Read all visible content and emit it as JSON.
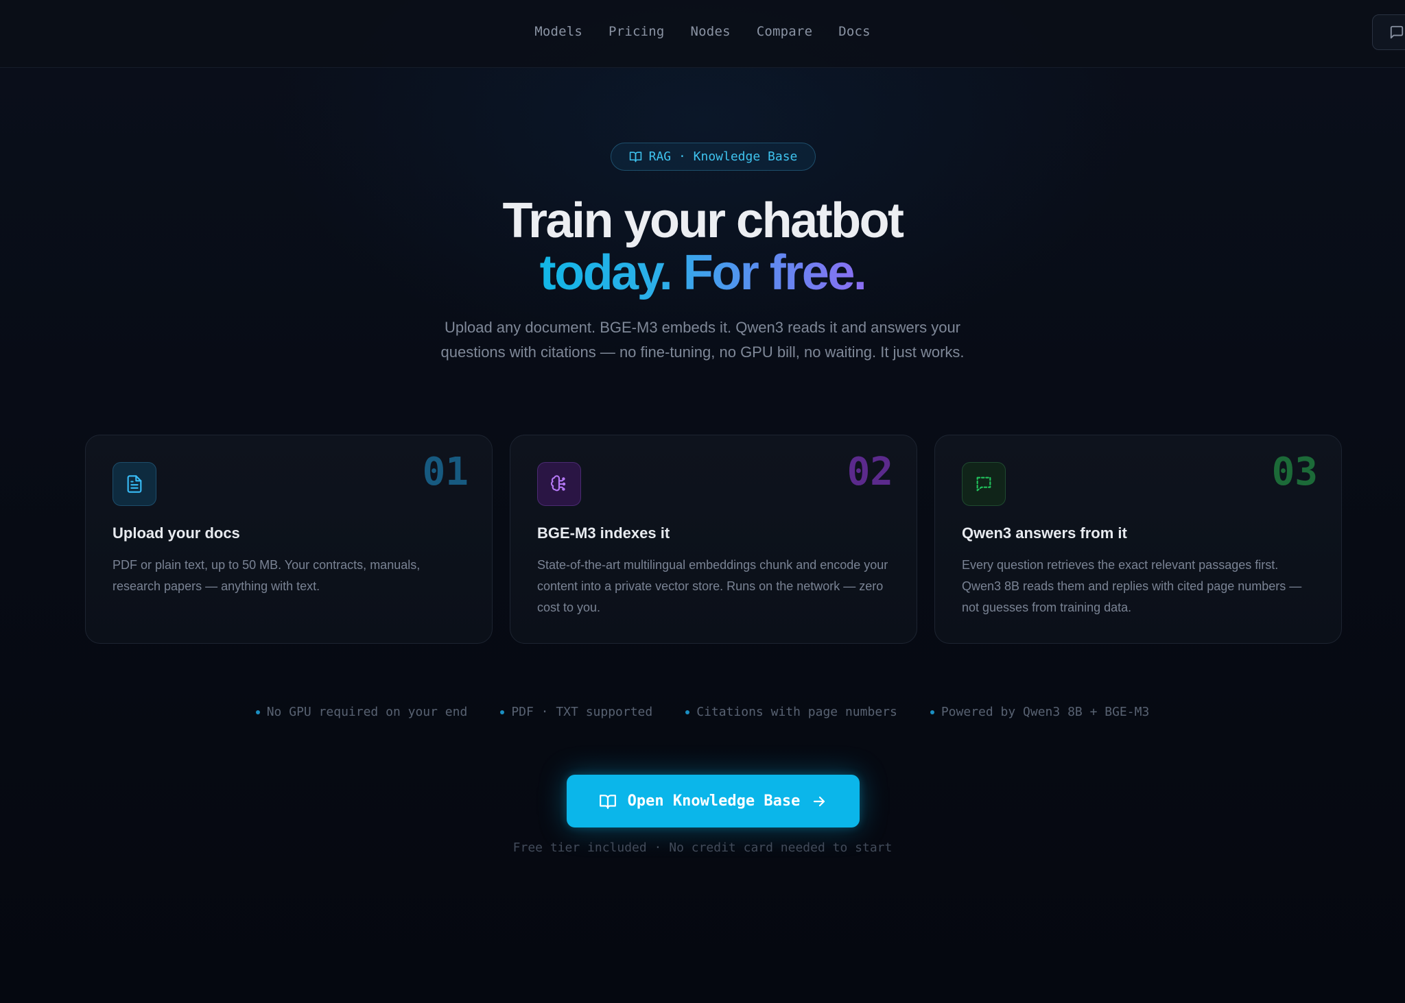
{
  "nav": {
    "items": [
      "Models",
      "Pricing",
      "Nodes",
      "Compare",
      "Docs"
    ],
    "chat_icon": "message-square-icon"
  },
  "hero": {
    "badge": "RAG · Knowledge Base",
    "badge_icon": "book-open-icon",
    "title_line1": "Train your chatbot",
    "title_line2": "today. For free.",
    "subtitle_line1": "Upload any document. BGE-M3 embeds it. Qwen3 reads it and answers your",
    "subtitle_line2": "questions with citations — no fine-tuning, no GPU bill, no waiting. It just works."
  },
  "cards": [
    {
      "number": "01",
      "title": "Upload your docs",
      "description": "PDF or plain text, up to 50 MB. Your contracts, manuals, research papers — anything with text.",
      "icon": "file-text-icon",
      "accent": "#38bdf8"
    },
    {
      "number": "02",
      "title": "BGE-M3 indexes it",
      "description": "State-of-the-art multilingual embeddings chunk and encode your content into a private vector store. Runs on the network — zero cost to you.",
      "icon": "brain-icon",
      "accent": "#a855f7"
    },
    {
      "number": "03",
      "title": "Qwen3 answers from it",
      "description": "Every question retrieves the exact relevant passages first. Qwen3 8B reads them and replies with cited page numbers — not guesses from training data.",
      "icon": "message-square-dashed-icon",
      "accent": "#22c55e"
    }
  ],
  "features": [
    "No GPU required on your end",
    "PDF · TXT supported",
    "Citations with page numbers",
    "Powered by Qwen3 8B + BGE-M3"
  ],
  "cta": {
    "label": "Open Knowledge Base",
    "icon": "book-open-icon",
    "arrow_icon": "arrow-right-icon",
    "note": "Free tier included · No credit card needed to start"
  },
  "colors": {
    "background": "#070b13",
    "cta": "#0bb6ea",
    "badge_text": "#3fc3ef"
  }
}
